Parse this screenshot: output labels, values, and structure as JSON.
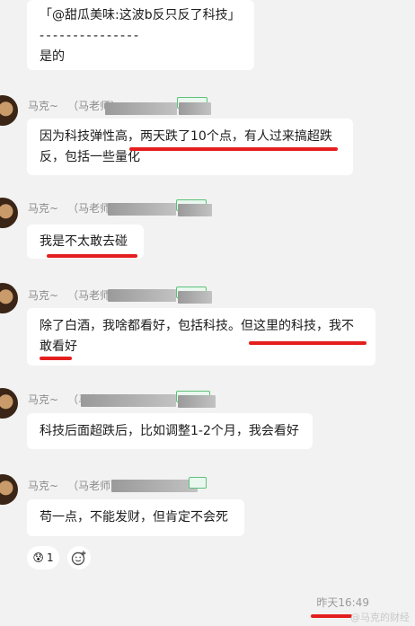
{
  "quote": {
    "line1": "「@甜瓜美味:这波b反只反了科技」",
    "divider": "- - - - - - - - - - - - - - -",
    "reply": "是的"
  },
  "sender": {
    "name": "马克~",
    "role": "（马老师）"
  },
  "messages": [
    {
      "text": "因为科技弹性高，两天跌了10个点，有人过来搞超跌反，包括一些量化"
    },
    {
      "text": "我是不太敢去碰"
    },
    {
      "text": "除了白酒，我啥都看好，包括科技。但这里的科技，我不敢看好"
    },
    {
      "text": "科技后面超跌后，比如调整1-2个月，我会看好"
    },
    {
      "text": "苟一点，不能发财，但肯定不会死"
    }
  ],
  "reaction": {
    "emoji": "😰",
    "count": "1",
    "add_icon": "add-reaction-icon"
  },
  "timestamp": "昨天16:49",
  "watermark": "@马克的财经"
}
